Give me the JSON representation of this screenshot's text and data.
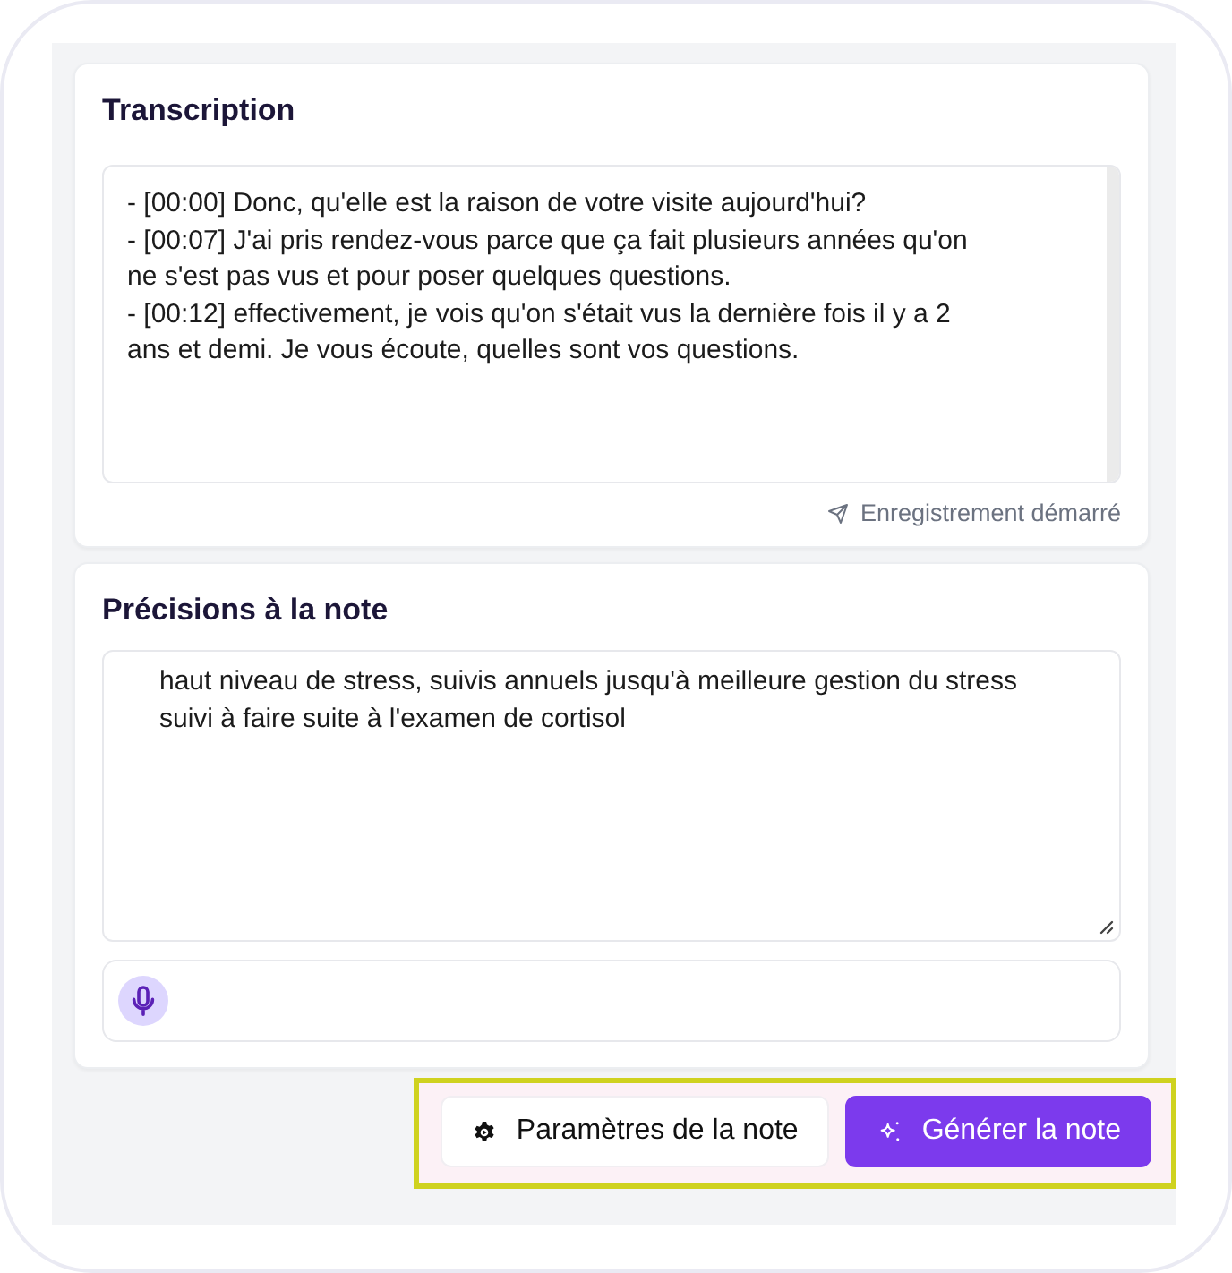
{
  "transcription": {
    "title": "Transcription",
    "lines": [
      "- [00:00] Donc, qu'elle est la raison de votre visite aujourd'hui?",
      "- [00:07] J'ai pris rendez-vous parce que ça fait plusieurs années qu'on ne s'est pas vus et pour poser quelques questions.",
      "- [00:12] effectivement, je vois qu'on s'était vus la dernière fois il y a 2 ans et demi. Je vous écoute, quelles sont vos questions."
    ],
    "status": "Enregistrement démarré"
  },
  "note_details": {
    "title": "Précisions à la note",
    "lines": [
      "haut niveau de stress, suivis annuels jusqu'à meilleure gestion du stress",
      "suivi à faire suite à l'examen de cortisol"
    ]
  },
  "actions": {
    "highlighted": true,
    "buttons": [
      {
        "label": "Paramètres de la note",
        "kind": "secondary"
      },
      {
        "label": "Générer la note",
        "kind": "primary"
      }
    ]
  }
}
